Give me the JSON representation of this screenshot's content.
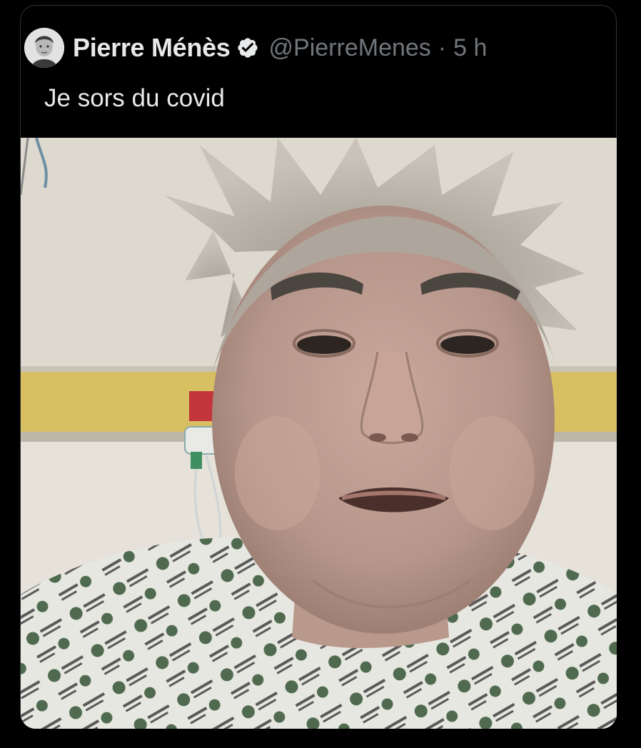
{
  "tweet": {
    "author_name": "Pierre Ménès",
    "handle": "@PierreMenes",
    "separator": "·",
    "time": "5 h",
    "text": "Je sors du covid",
    "verified": true
  },
  "icons": {
    "verified": "verified-badge-icon",
    "avatar": "profile-photo"
  },
  "colors": {
    "background": "#000000",
    "primary_text": "#e7e9ea",
    "secondary_text": "#71767b",
    "card_border": "#2f3336"
  }
}
